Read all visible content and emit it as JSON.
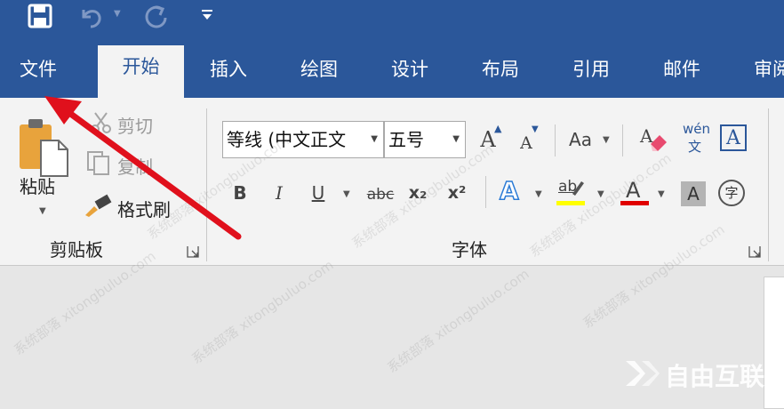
{
  "tabs": [
    "文件",
    "开始",
    "插入",
    "绘图",
    "设计",
    "布局",
    "引用",
    "邮件",
    "审阅"
  ],
  "clipboard": {
    "paste": "粘贴",
    "cut": "剪切",
    "copy": "复制",
    "format_painter": "格式刷",
    "group_label": "剪贴板"
  },
  "font": {
    "name": "等线 (中文正文",
    "size": "五号",
    "group_label": "字体",
    "change_case": "Aa",
    "phonetic_top": "wén",
    "phonetic_bottom": "文",
    "bold": "B",
    "italic": "I",
    "underline": "U",
    "strike": "abc",
    "subscript": "x₂",
    "superscript": "x²",
    "grow": "A",
    "shrink": "A",
    "border_char": "A",
    "shade_char": "A",
    "enclose_char": "字",
    "highlight": "ab",
    "color_a": "A",
    "effect_a": "A"
  },
  "watermark": {
    "text": "系统部落 xitongbuluo.com",
    "logo": "自由互联"
  },
  "colors": {
    "ribbon_blue": "#2b579a",
    "highlight_yellow": "#ffff00",
    "font_red": "#e00000",
    "arrow_red": "#e0101c"
  }
}
